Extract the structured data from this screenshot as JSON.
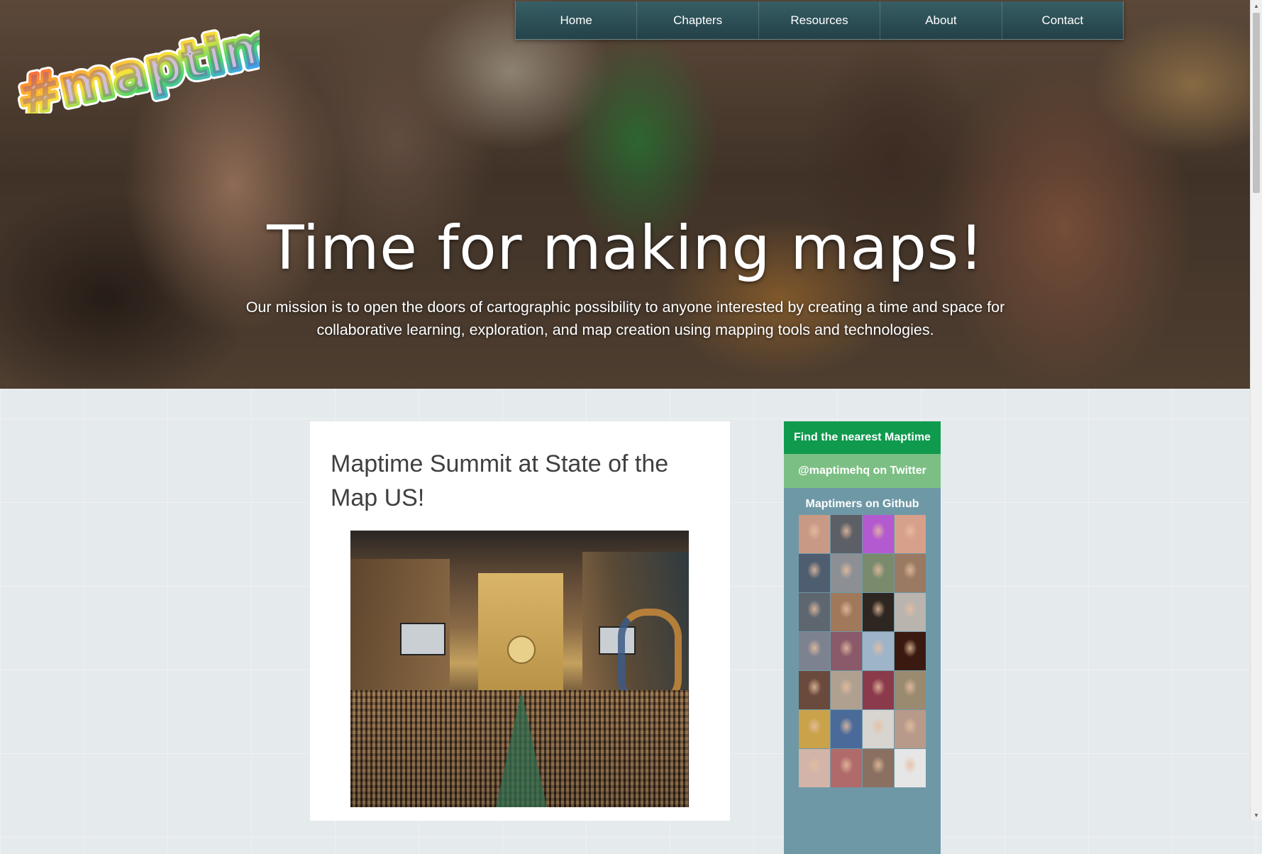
{
  "logo": {
    "text": "#maptime!"
  },
  "nav": {
    "items": [
      {
        "label": "Home"
      },
      {
        "label": "Chapters"
      },
      {
        "label": "Resources"
      },
      {
        "label": "About"
      },
      {
        "label": "Contact"
      }
    ]
  },
  "hero": {
    "title": "Time for making maps!",
    "mission": "Our mission is to open the doors of cartographic possibility to anyone interested by creating a time and space for collaborative learning, exploration, and map creation using mapping tools and technologies."
  },
  "article": {
    "title": "Maptime Summit at State of the Map US!"
  },
  "sidebar": {
    "find_label": "Find the nearest Maptime",
    "twitter_label": "@maptimehq on Twitter",
    "github_title": "Maptimers on Github",
    "avatars": [
      "#c89a86",
      "#5c5f66",
      "#b45ad0",
      "#d7a08a",
      "#4f5d70",
      "#8c8f94",
      "#7a8a6c",
      "#9a7a62",
      "#5e6770",
      "#a0785a",
      "#2e2620",
      "#b9b4ae",
      "#7d8290",
      "#8a5a6a",
      "#9eb4c8",
      "#3a1a10",
      "#6a4a3c",
      "#b0a090",
      "#8a3a4a",
      "#9a8a70",
      "#c9a24a",
      "#4a6a9a",
      "#d8d4d0",
      "#b89a8a",
      "#d2b4a8",
      "#b06a6a",
      "#8a7060",
      "#e6e6e6"
    ]
  },
  "colors": {
    "find_button": "#0f9a4e",
    "twitter_button": "#7cbf84",
    "github_panel": "#6f98a6",
    "nav_bg": "#2c5560"
  }
}
